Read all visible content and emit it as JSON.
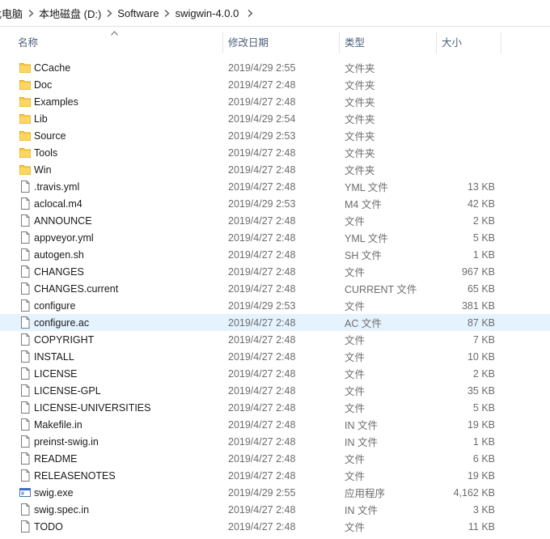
{
  "breadcrumb": {
    "items": [
      "此电脑",
      "本地磁盘 (D:)",
      "Software",
      "swigwin-4.0.0"
    ]
  },
  "columns": {
    "name": "名称",
    "date": "修改日期",
    "type": "类型",
    "size": "大小"
  },
  "files": [
    {
      "name": "CCache",
      "date": "2019/4/29 2:55",
      "type": "文件夹",
      "size": "",
      "icon": "folder-icon"
    },
    {
      "name": "Doc",
      "date": "2019/4/27 2:48",
      "type": "文件夹",
      "size": "",
      "icon": "folder-icon"
    },
    {
      "name": "Examples",
      "date": "2019/4/27 2:48",
      "type": "文件夹",
      "size": "",
      "icon": "folder-icon"
    },
    {
      "name": "Lib",
      "date": "2019/4/29 2:54",
      "type": "文件夹",
      "size": "",
      "icon": "folder-icon"
    },
    {
      "name": "Source",
      "date": "2019/4/29 2:53",
      "type": "文件夹",
      "size": "",
      "icon": "folder-icon"
    },
    {
      "name": "Tools",
      "date": "2019/4/27 2:48",
      "type": "文件夹",
      "size": "",
      "icon": "folder-icon"
    },
    {
      "name": "Win",
      "date": "2019/4/27 2:48",
      "type": "文件夹",
      "size": "",
      "icon": "folder-icon"
    },
    {
      "name": ".travis.yml",
      "date": "2019/4/27 2:48",
      "type": "YML 文件",
      "size": "13 KB",
      "icon": "file-icon"
    },
    {
      "name": "aclocal.m4",
      "date": "2019/4/29 2:53",
      "type": "M4 文件",
      "size": "42 KB",
      "icon": "file-icon"
    },
    {
      "name": "ANNOUNCE",
      "date": "2019/4/27 2:48",
      "type": "文件",
      "size": "2 KB",
      "icon": "file-icon"
    },
    {
      "name": "appveyor.yml",
      "date": "2019/4/27 2:48",
      "type": "YML 文件",
      "size": "5 KB",
      "icon": "file-icon"
    },
    {
      "name": "autogen.sh",
      "date": "2019/4/27 2:48",
      "type": "SH 文件",
      "size": "1 KB",
      "icon": "file-icon"
    },
    {
      "name": "CHANGES",
      "date": "2019/4/27 2:48",
      "type": "文件",
      "size": "967 KB",
      "icon": "file-icon"
    },
    {
      "name": "CHANGES.current",
      "date": "2019/4/27 2:48",
      "type": "CURRENT 文件",
      "size": "65 KB",
      "icon": "file-icon"
    },
    {
      "name": "configure",
      "date": "2019/4/29 2:53",
      "type": "文件",
      "size": "381 KB",
      "icon": "file-icon"
    },
    {
      "name": "configure.ac",
      "date": "2019/4/27 2:48",
      "type": "AC 文件",
      "size": "87 KB",
      "icon": "file-icon",
      "hover": true
    },
    {
      "name": "COPYRIGHT",
      "date": "2019/4/27 2:48",
      "type": "文件",
      "size": "7 KB",
      "icon": "file-icon"
    },
    {
      "name": "INSTALL",
      "date": "2019/4/27 2:48",
      "type": "文件",
      "size": "10 KB",
      "icon": "file-icon"
    },
    {
      "name": "LICENSE",
      "date": "2019/4/27 2:48",
      "type": "文件",
      "size": "2 KB",
      "icon": "file-icon"
    },
    {
      "name": "LICENSE-GPL",
      "date": "2019/4/27 2:48",
      "type": "文件",
      "size": "35 KB",
      "icon": "file-icon"
    },
    {
      "name": "LICENSE-UNIVERSITIES",
      "date": "2019/4/27 2:48",
      "type": "文件",
      "size": "5 KB",
      "icon": "file-icon"
    },
    {
      "name": "Makefile.in",
      "date": "2019/4/27 2:48",
      "type": "IN 文件",
      "size": "19 KB",
      "icon": "file-icon"
    },
    {
      "name": "preinst-swig.in",
      "date": "2019/4/27 2:48",
      "type": "IN 文件",
      "size": "1 KB",
      "icon": "file-icon"
    },
    {
      "name": "README",
      "date": "2019/4/27 2:48",
      "type": "文件",
      "size": "6 KB",
      "icon": "file-icon"
    },
    {
      "name": "RELEASENOTES",
      "date": "2019/4/27 2:48",
      "type": "文件",
      "size": "19 KB",
      "icon": "file-icon"
    },
    {
      "name": "swig.exe",
      "date": "2019/4/29 2:55",
      "type": "应用程序",
      "size": "4,162 KB",
      "icon": "exe-icon"
    },
    {
      "name": "swig.spec.in",
      "date": "2019/4/27 2:48",
      "type": "IN 文件",
      "size": "3 KB",
      "icon": "file-icon"
    },
    {
      "name": "TODO",
      "date": "2019/4/27 2:48",
      "type": "文件",
      "size": "11 KB",
      "icon": "file-icon"
    }
  ],
  "colors": {
    "folder": "#f8c840",
    "folder_dark": "#e2a91e",
    "hover_bg": "#e5f3ff",
    "header_text": "#4c607a"
  }
}
